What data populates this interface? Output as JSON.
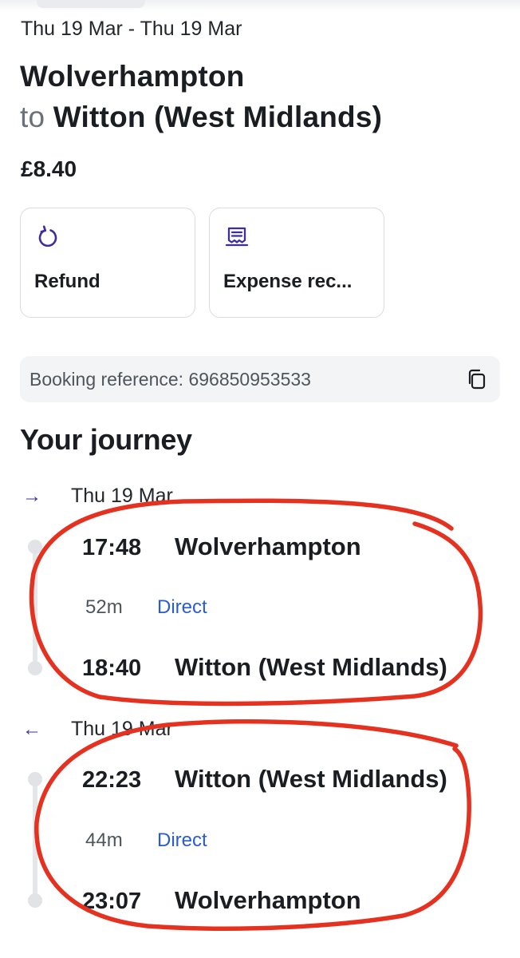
{
  "header": {
    "dates": "Thu 19 Mar - Thu 19 Mar",
    "origin": "Wolverhampton",
    "to_word": "to",
    "destination": "Witton (West Midlands)",
    "price": "£8.40"
  },
  "actions": [
    {
      "label": "Refund",
      "icon": "refund-icon"
    },
    {
      "label": "Expense rec...",
      "icon": "receipt-icon"
    }
  ],
  "booking": {
    "text": "Booking reference: 696850953533",
    "copy_icon": "copy-icon"
  },
  "journey": {
    "title": "Your journey",
    "outbound": {
      "arrow": "→",
      "date": "Thu 19 Mar",
      "depart_time": "17:48",
      "depart_station": "Wolverhampton",
      "duration": "52m",
      "type": "Direct",
      "arrive_time": "18:40",
      "arrive_station": "Witton (West Midlands)"
    },
    "return": {
      "arrow": "←",
      "date": "Thu 19 Mar",
      "depart_time": "22:23",
      "depart_station": "Witton (West Midlands)",
      "duration": "44m",
      "type": "Direct",
      "arrive_time": "23:07",
      "arrive_station": "Wolverhampton"
    }
  },
  "colors": {
    "accent": "#3d2e9c",
    "link": "#2a5bd7",
    "annotation": "#e5311f"
  }
}
